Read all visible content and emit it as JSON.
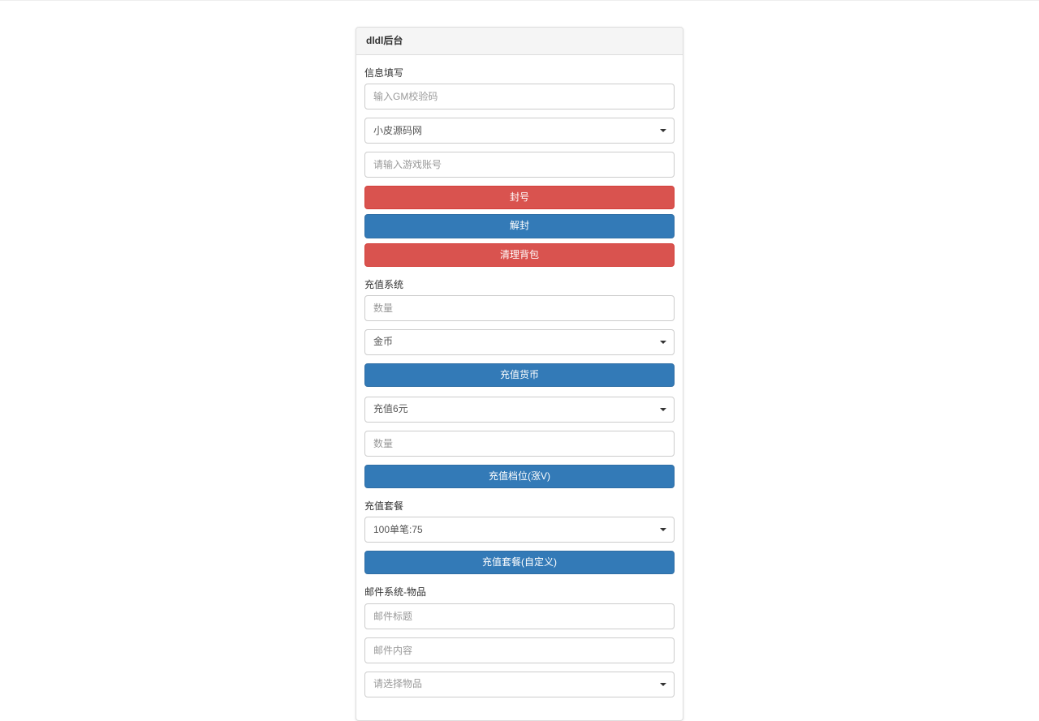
{
  "panel": {
    "title": "dldl后台"
  },
  "section_info": {
    "label": "信息填写",
    "gm_code_placeholder": "输入GM校验码",
    "server_select": "小皮源码网",
    "account_placeholder": "请输入游戏账号",
    "ban_btn": "封号",
    "unban_btn": "解封",
    "clear_bag_btn": "清理背包"
  },
  "section_recharge": {
    "label": "充值系统",
    "quantity_placeholder": "数量",
    "currency_select": "金币",
    "recharge_currency_btn": "充值货币",
    "tier_select": "充值6元",
    "tier_quantity_placeholder": "数量",
    "recharge_tier_btn": "充值档位(涨V)"
  },
  "section_package": {
    "label": "充值套餐",
    "package_select": "100单笔:75",
    "package_btn": "充值套餐(自定义)"
  },
  "section_mail": {
    "label": "邮件系统-物品",
    "title_placeholder": "邮件标题",
    "content_placeholder": "邮件内容",
    "item_select_placeholder": "请选择物品"
  }
}
